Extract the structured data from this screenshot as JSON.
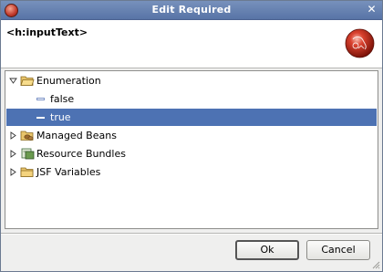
{
  "window": {
    "title": "Edit Required"
  },
  "header": {
    "tag": "<h:inputText>"
  },
  "tree": {
    "nodes": [
      {
        "label": "Enumeration",
        "expanded": true,
        "icon": "folder-open-icon"
      },
      {
        "label": "false",
        "icon": "value-leaf-icon"
      },
      {
        "label": "true",
        "icon": "value-leaf-icon",
        "selected": true
      },
      {
        "label": "Managed Beans",
        "expanded": false,
        "icon": "beans-folder-icon"
      },
      {
        "label": "Resource Bundles",
        "expanded": false,
        "icon": "bundle-icon"
      },
      {
        "label": "JSF Variables",
        "expanded": false,
        "icon": "folder-icon"
      }
    ]
  },
  "buttons": {
    "ok": "Ok",
    "cancel": "Cancel"
  },
  "colors": {
    "titlebar": "#5874a6",
    "selection": "#4d72b3"
  }
}
